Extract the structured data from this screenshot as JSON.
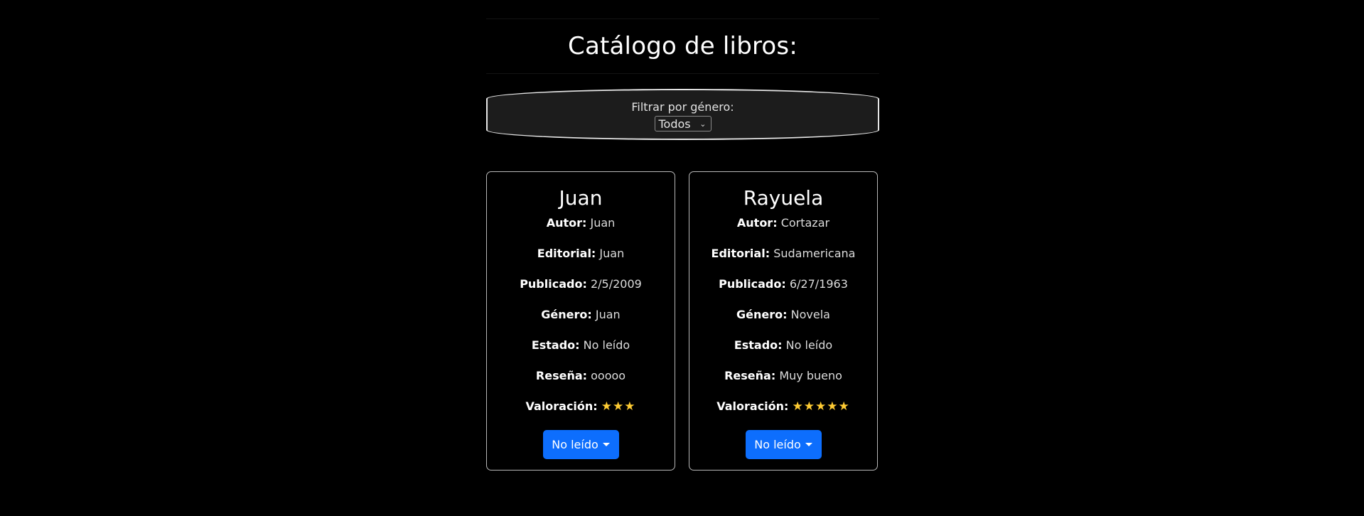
{
  "page": {
    "title": "Catálogo de libros:"
  },
  "filter": {
    "label": "Filtrar por género:",
    "selected": "Todos"
  },
  "books": [
    {
      "title": "Juan",
      "author_label": "Autor:",
      "author": "Juan",
      "publisher_label": "Editorial:",
      "publisher": "Juan",
      "published_label": "Publicado:",
      "published": "2/5/2009",
      "genre_label": "Género:",
      "genre": "Juan",
      "status_label": "Estado:",
      "status": "No leído",
      "review_label": "Reseña:",
      "review": "ooooo",
      "rating_label": "Valoración:",
      "rating": 3,
      "button_label": "No leído"
    },
    {
      "title": "Rayuela",
      "author_label": "Autor:",
      "author": "Cortazar",
      "publisher_label": "Editorial:",
      "publisher": "Sudamericana",
      "published_label": "Publicado:",
      "published": "6/27/1963",
      "genre_label": "Género:",
      "genre": "Novela",
      "status_label": "Estado:",
      "status": "No leído",
      "review_label": "Reseña:",
      "review": "Muy bueno",
      "rating_label": "Valoración:",
      "rating": 5,
      "button_label": "No leído"
    }
  ],
  "colors": {
    "background": "#000000",
    "button": "#0d6efd",
    "star": "#ffcc33",
    "card_border": "#b8b8b8"
  }
}
